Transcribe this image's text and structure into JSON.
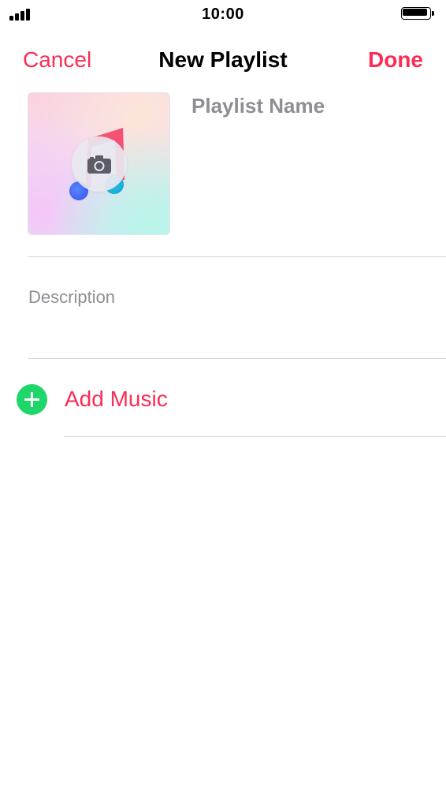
{
  "status_bar": {
    "time": "10:00",
    "signal_icon": "cellular-signal-icon",
    "battery_icon": "battery-full-icon",
    "battery_level": 1.0
  },
  "nav": {
    "cancel_label": "Cancel",
    "title": "New Playlist",
    "done_label": "Done"
  },
  "artwork": {
    "camera_icon": "camera-icon",
    "music_note_icon": "music-note-icon"
  },
  "form": {
    "playlist_name_value": "",
    "playlist_name_placeholder": "Playlist Name",
    "description_value": "",
    "description_placeholder": "Description"
  },
  "add_music": {
    "label": "Add Music",
    "icon": "plus-circle-icon"
  },
  "colors": {
    "accent": "#fa2d55",
    "add_green": "#1fd66a",
    "placeholder_gray": "#8e8e93",
    "separator": "#d6d6db"
  }
}
